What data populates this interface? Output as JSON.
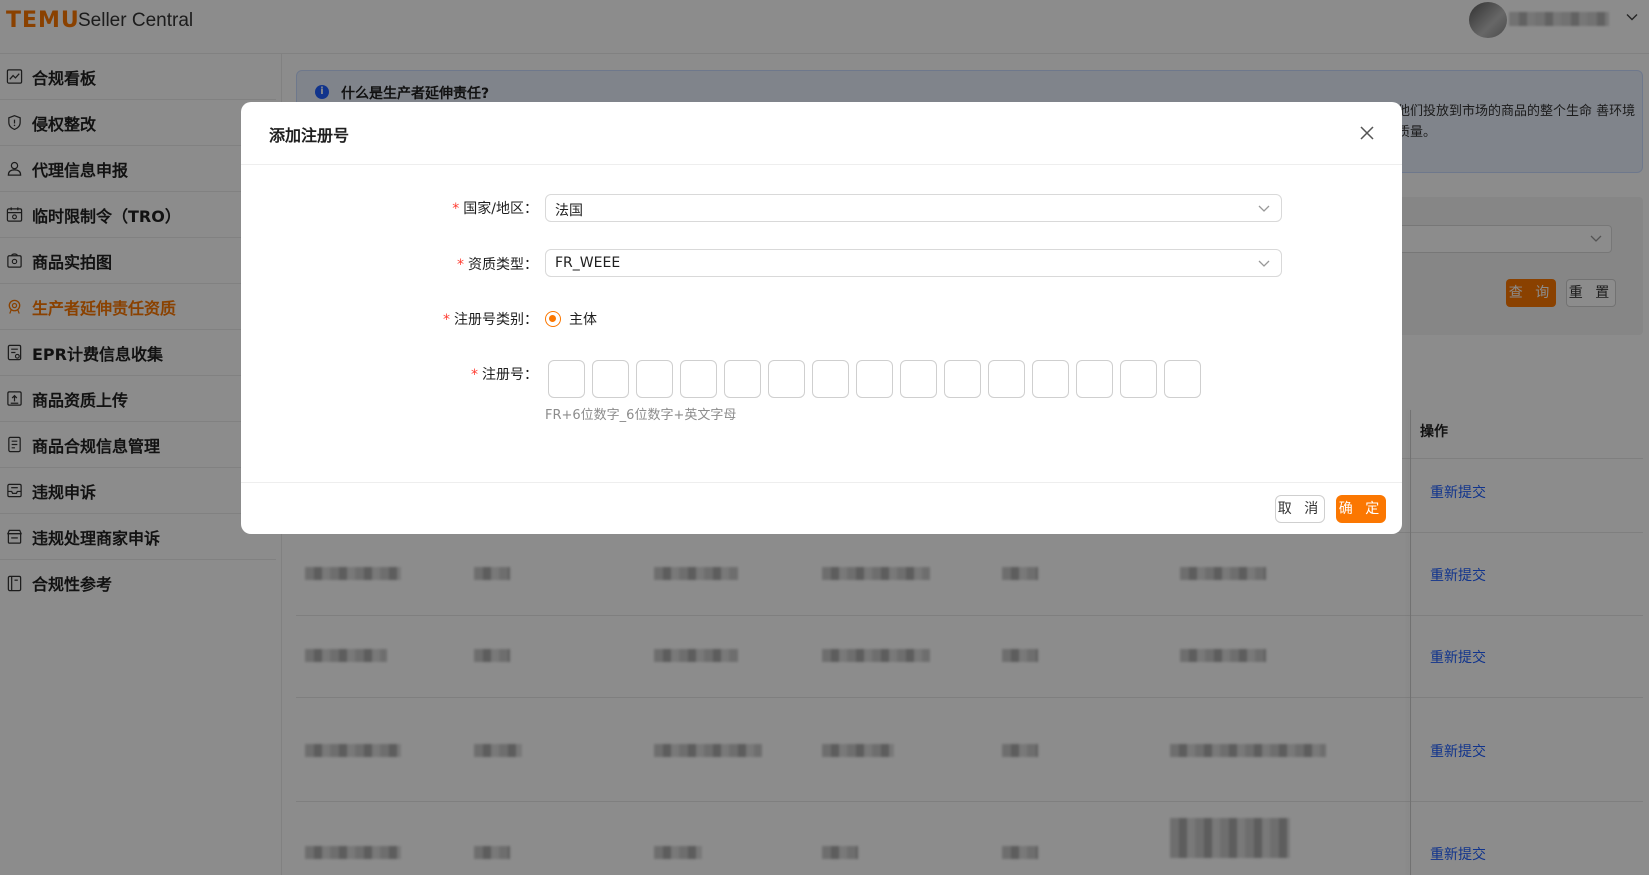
{
  "header": {
    "brand_logo": "TEMU",
    "brand_sub": "Seller Central",
    "brand_color": "#fb7701",
    "user_chevron_icon": "chevron-down-icon"
  },
  "sidebar": {
    "items": [
      {
        "label": "合规看板",
        "icon": "chart-icon"
      },
      {
        "label": "侵权整改",
        "icon": "shield-icon"
      },
      {
        "label": "代理信息申报",
        "icon": "user-icon"
      },
      {
        "label": "临时限制令（TRO）",
        "icon": "calendar-icon"
      },
      {
        "label": "商品实拍图",
        "icon": "bag-camera-icon"
      },
      {
        "label": "生产者延伸责任资质",
        "icon": "badge-icon",
        "active": true
      },
      {
        "label": "EPR计费信息收集",
        "icon": "receipt-icon"
      },
      {
        "label": "商品资质上传",
        "icon": "upload-icon"
      },
      {
        "label": "商品合规信息管理",
        "icon": "document-icon"
      },
      {
        "label": "违规申诉",
        "icon": "inbox-icon"
      },
      {
        "label": "违规处理商家申诉",
        "icon": "store-icon"
      },
      {
        "label": "合规性参考",
        "icon": "book-icon"
      }
    ]
  },
  "info": {
    "title": "什么是生产者延伸责任?",
    "text_visible": "他们投放到市场的商品的整个生命 善环境质量。"
  },
  "filter": {
    "query_label": "查 询",
    "reset_label": "重 置"
  },
  "table": {
    "op_header": "操作",
    "row_action": "重新提交"
  },
  "modal": {
    "title": "添加注册号",
    "fields": {
      "country": {
        "label": "国家/地区",
        "value": "法国"
      },
      "qualification": {
        "label": "资质类型",
        "value": "FR_WEEE"
      },
      "reg_category": {
        "label": "注册号类别",
        "option": "主体"
      },
      "reg_number": {
        "label": "注册号",
        "hint": "FR+6位数字_6位数字+英文字母"
      }
    },
    "cancel_label": "取 消",
    "confirm_label": "确 定"
  }
}
